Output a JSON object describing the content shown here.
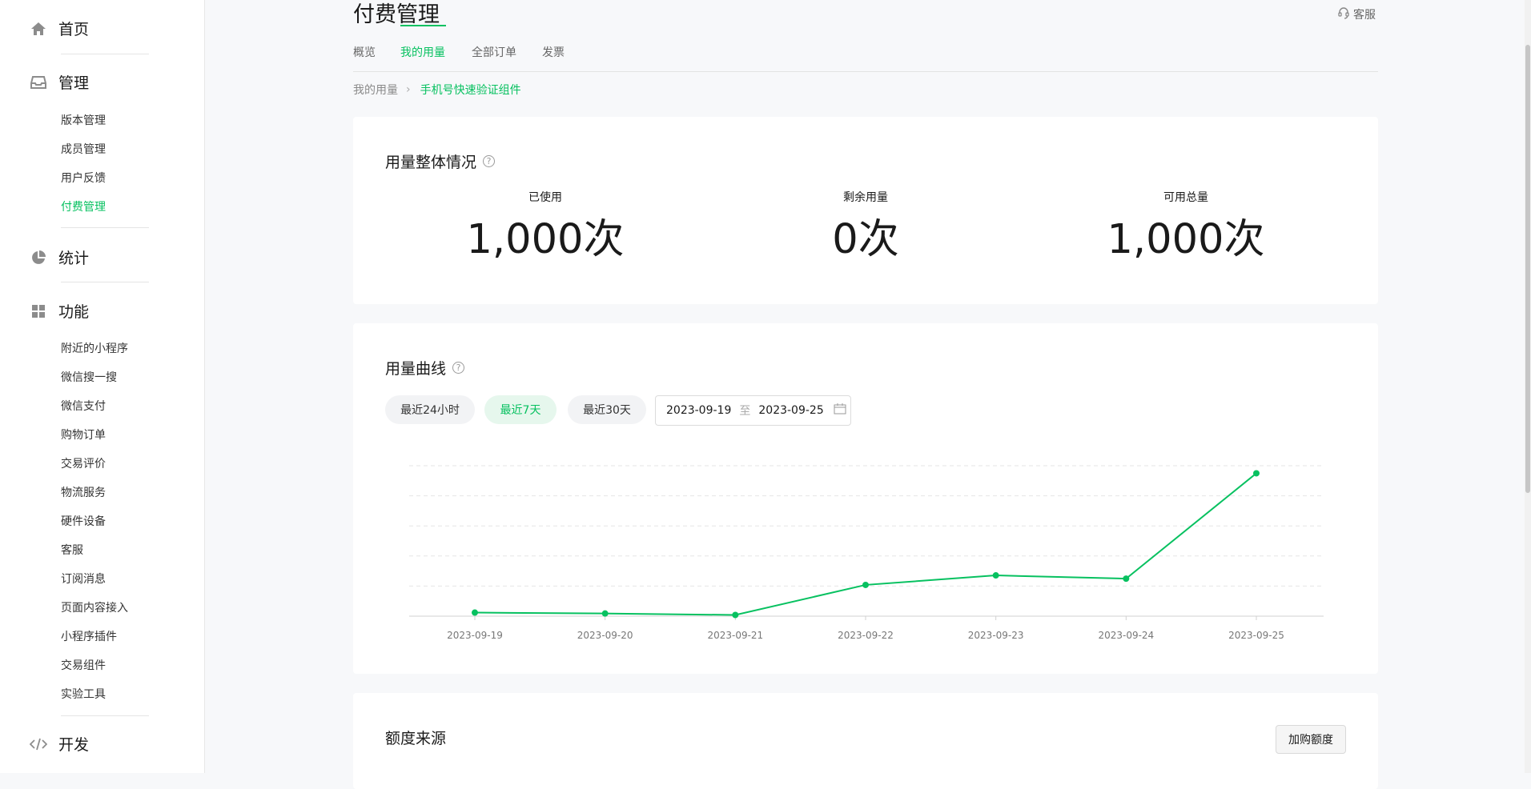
{
  "sidebar": {
    "sections": [
      {
        "label": "首页",
        "icon": "home-icon"
      },
      {
        "label": "管理",
        "icon": "inbox-icon"
      },
      {
        "label": "统计",
        "icon": "pie-chart-icon"
      },
      {
        "label": "功能",
        "icon": "grid-icon"
      },
      {
        "label": "开发",
        "icon": "code-icon"
      }
    ],
    "manage_items": [
      "版本管理",
      "成员管理",
      "用户反馈",
      "付费管理"
    ],
    "function_items": [
      "附近的小程序",
      "微信搜一搜",
      "微信支付",
      "购物订单",
      "交易评价",
      "物流服务",
      "硬件设备",
      "客服",
      "订阅消息",
      "页面内容接入",
      "小程序插件",
      "交易组件",
      "实验工具"
    ]
  },
  "header": {
    "title": "付费管理",
    "service": "客服",
    "tabs": [
      "概览",
      "我的用量",
      "全部订单",
      "发票"
    ],
    "active_tab": "我的用量"
  },
  "breadcrumb": {
    "parent": "我的用量",
    "current": "手机号快速验证组件"
  },
  "overview": {
    "title": "用量整体情况",
    "stats": [
      {
        "label": "已使用",
        "value": "1,000次"
      },
      {
        "label": "剩余用量",
        "value": "0次"
      },
      {
        "label": "可用总量",
        "value": "1,000次"
      }
    ]
  },
  "usage_curve": {
    "title": "用量曲线",
    "ranges": [
      "最近24小时",
      "最近7天",
      "最近30天"
    ],
    "active_range": "最近7天",
    "date_from": "2023-09-19",
    "date_sep": "至",
    "date_to": "2023-09-25"
  },
  "chart_data": {
    "type": "line",
    "x": [
      "2023-09-19",
      "2023-09-20",
      "2023-09-21",
      "2023-09-22",
      "2023-09-23",
      "2023-09-24",
      "2023-09-25"
    ],
    "series": [
      {
        "values": [
          12,
          9,
          4,
          105,
          137,
          126,
          480
        ]
      }
    ],
    "ylim": [
      0,
      500
    ],
    "grid": "horizontal dashed",
    "color": "#07c160"
  },
  "quota": {
    "title": "额度来源",
    "buy_button": "加购额度"
  },
  "colors": {
    "accent": "#07c160",
    "background": "#f7f8fa"
  }
}
